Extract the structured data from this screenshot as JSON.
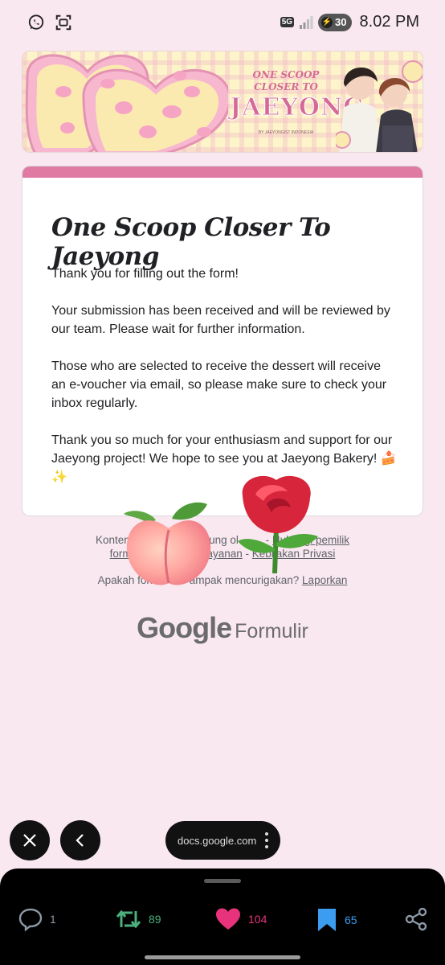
{
  "status_bar": {
    "time": "8.02 PM",
    "battery": "30",
    "network": "5G",
    "icons": [
      "whatsapp-icon",
      "screenshot-icon",
      "signal-icon",
      "battery-icon"
    ]
  },
  "banner": {
    "line1": "ONE SCOOP",
    "line2": "CLOSER TO",
    "line3": "JAEYONG",
    "credit": "BY JAEYONGIST INDONESIA"
  },
  "form": {
    "title": "One Scoop Closer To Jaeyong",
    "accent_color": "#e07aa3",
    "paragraphs": [
      "Thank you for filling out the form!",
      "Your submission has been received and will be reviewed by our team. Please wait for further information.",
      "Those who are selected to receive the dessert will receive an e-voucher via email, so please make sure to check your inbox regularly.",
      "Thank you so much for your enthusiasm and support for our Jaeyong project! We hope to see you at Jaeyong Bakery! 🍰✨"
    ]
  },
  "footer": {
    "line1_prefix": "Konten ini tida",
    "line1_mid": "ktung ol",
    "line1_link1": "Hubungi pemilik",
    "line2_link1": "form",
    "line2_link2": "Layanan",
    "line2_link3": "Kebijakan Privasi",
    "report_prefix": "Apakah form",
    "report_mid": "ampak mencurigakan?",
    "report_link": "Laporkan",
    "logo_google": "Google",
    "logo_product": "Formulir"
  },
  "stickers": [
    "peach-emoji",
    "rose-emoji"
  ],
  "browser": {
    "url": "docs.google.com"
  },
  "actions": {
    "reply_count": "1",
    "retweet_count": "89",
    "like_count": "104",
    "bookmark_count": "65",
    "colors": {
      "retweet": "#4caf7d",
      "like": "#e8337c",
      "bookmark": "#3b9cf0"
    }
  }
}
